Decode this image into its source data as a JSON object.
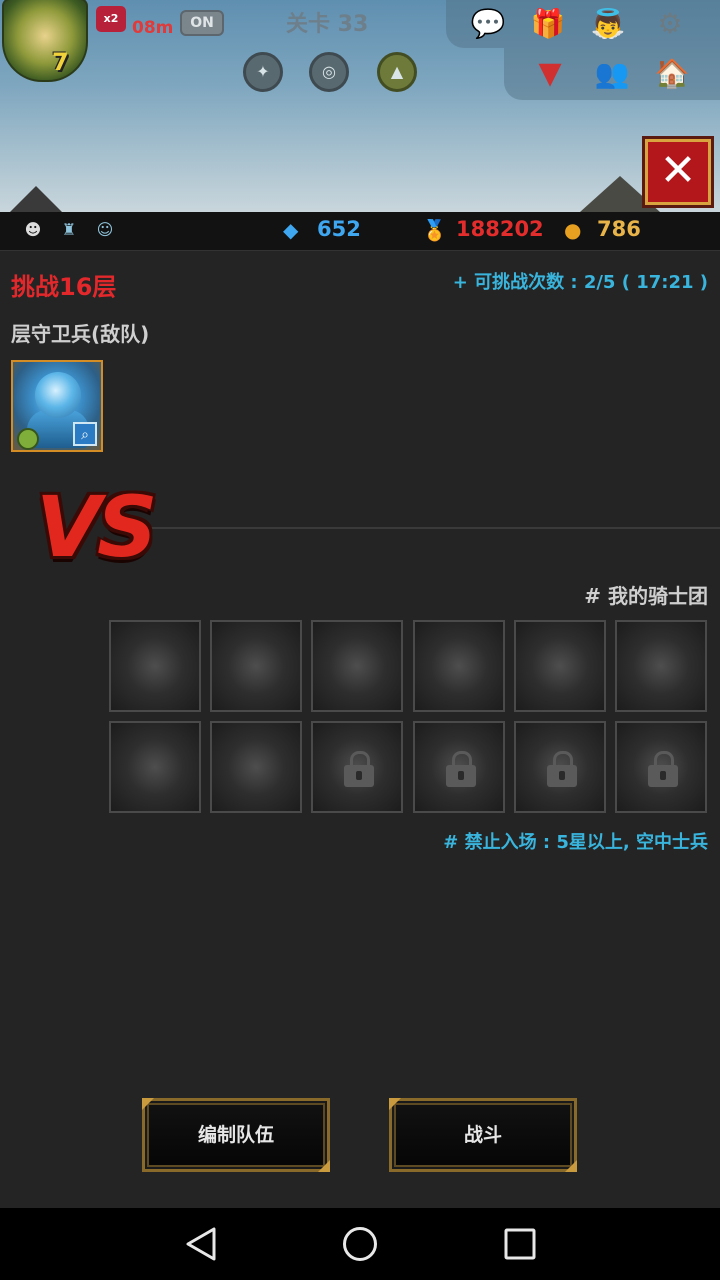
{
  "hud": {
    "player_level": "7",
    "speed_label": "x2",
    "timer": "08m",
    "auto_toggle": "ON",
    "stage_title": "关卡 33"
  },
  "resources": {
    "gems": "652",
    "medals": "188202",
    "gold": "786"
  },
  "challenge": {
    "title": "挑战16层",
    "attempts": "+ 可挑战次数 : 2/5 ( 17:21 )",
    "guard_label": "层守卫兵(敌队)"
  },
  "vs_label": "VS",
  "my_team_label": "# 我的骑士团",
  "slots": {
    "open_count": 8,
    "locked_count": 4
  },
  "restriction": "# 禁止入场 : 5星以上, 空中士兵",
  "buttons": {
    "edit_team": "编制队伍",
    "battle": "战斗"
  },
  "icons": [
    "speed-icon",
    "chat-icon",
    "gift-icon",
    "angel-icon",
    "gear-icon",
    "dropdown-icon",
    "friends-icon",
    "home-icon",
    "close-icon",
    "gem-icon",
    "medal-icon",
    "gold-coin-icon",
    "lock-icon",
    "back-icon",
    "home-circle-icon",
    "recents-icon"
  ],
  "colors": {
    "accent_red": "#e3282c",
    "accent_blue": "#39b4dd",
    "gold_border": "#c99a3e"
  }
}
